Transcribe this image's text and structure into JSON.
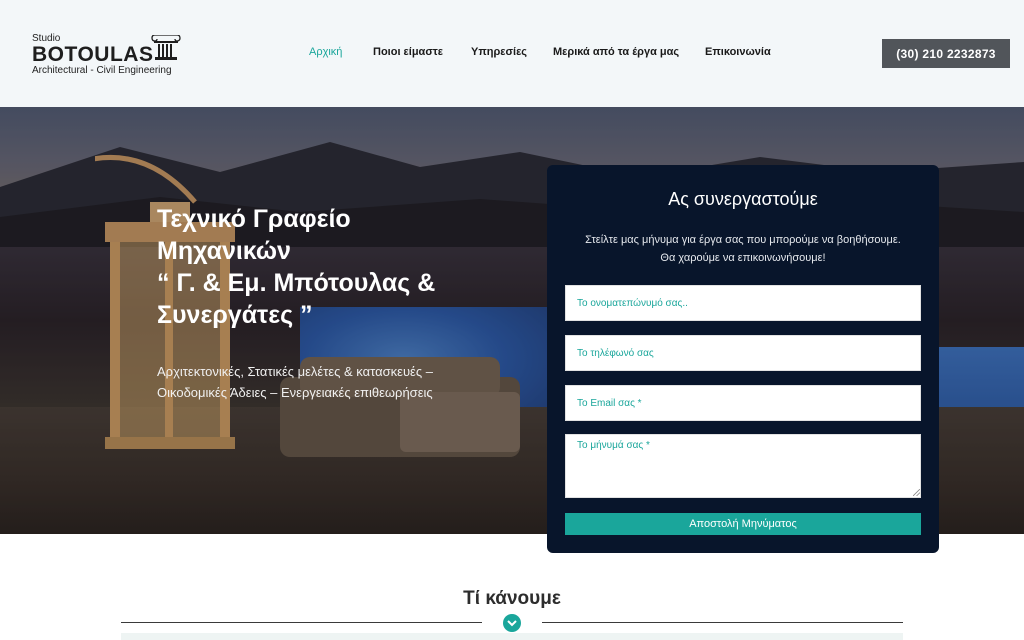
{
  "header": {
    "logo": {
      "studio": "Studio",
      "name": "BOTOULAS",
      "subtitle": "Architectural - Civil Engineering"
    },
    "nav": [
      {
        "label": "Αρχική",
        "active": true
      },
      {
        "label": "Ποιοι είμαστε",
        "active": false
      },
      {
        "label": "Υπηρεσίες",
        "active": false
      },
      {
        "label": "Μερικά από τα έργα μας",
        "active": false
      },
      {
        "label": "Επικοινωνία",
        "active": false
      }
    ],
    "phone": "(30) 210 2232873"
  },
  "hero": {
    "title_lines": [
      "Τεχνικό Γραφείο",
      "Μηχανικών",
      "“ Γ. & Εμ. Μπότουλας &",
      "Συνεργάτες ”"
    ],
    "subtitle_lines": [
      "Αρχιτεκτονικές, Στατικές μελέτες & κατασκευές –",
      "Οικοδομικές Άδειες – Ενεργειακές επιθεωρήσεις"
    ]
  },
  "contact_form": {
    "title": "Ας συνεργαστούμε",
    "intro_lines": [
      "Στείλτε μας μήνυμα για έργα σας που μπορούμε να βοηθήσουμε.",
      "Θα χαρούμε να επικοινωνήσουμε!"
    ],
    "name_placeholder": "Το ονοματεπώνυμό σας..",
    "phone_placeholder": "Το τηλέφωνό σας",
    "email_placeholder": "Το Email σας *",
    "message_placeholder": "Το μήνυμά σας *",
    "submit_label": "Αποστολή Μηνύματος"
  },
  "section": {
    "title": "Τί κάνουμε"
  },
  "colors": {
    "accent": "#1aa69b",
    "header_bg": "#f3f7f9",
    "form_bg": "#08152b",
    "phone_button_bg": "#51555a"
  },
  "icons": {
    "logo_mark": "ionic-column-icon",
    "section_divider": "chevron-down-icon"
  }
}
